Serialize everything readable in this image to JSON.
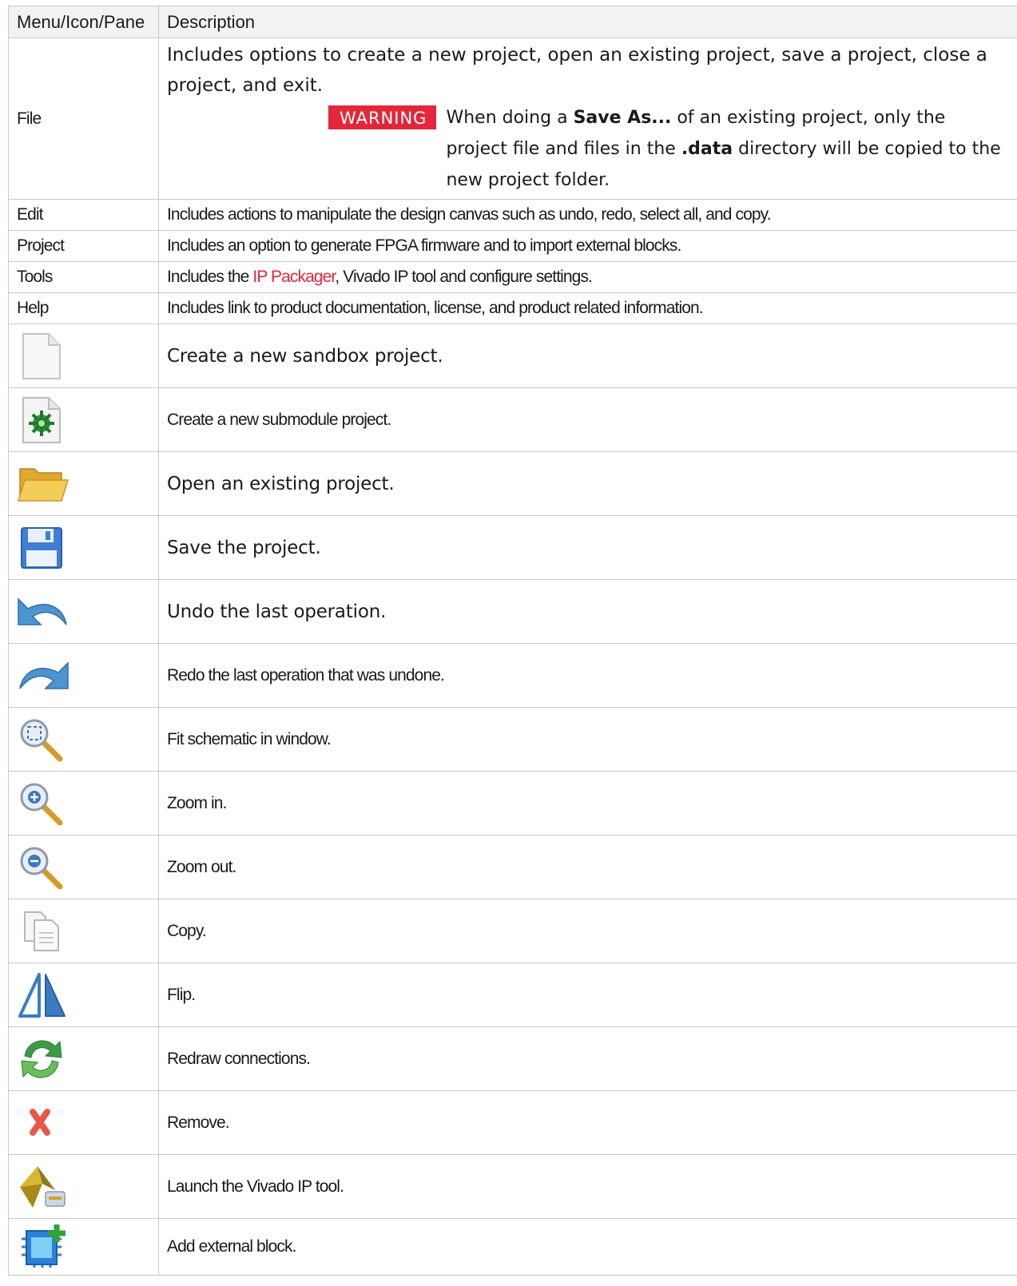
{
  "header": {
    "col1": "Menu/Icon/Pane",
    "col2": "Description"
  },
  "menus": [
    {
      "name": "File",
      "desc": "Includes options to create a new project, open an existing project, save a project, close a project, and exit.",
      "warning": {
        "badge": "WARNING",
        "pre": "When doing a ",
        "b1": "Save As...",
        "mid": " of an existing project, only the project file and files in the ",
        "b2": ".data",
        "post": " directory will be copied to the new project folder."
      }
    },
    {
      "name": "Edit",
      "desc": "Includes actions to manipulate the design canvas such as undo, redo, select all, and copy."
    },
    {
      "name": "Project",
      "desc": "Includes an option to generate FPGA firmware and to import external blocks."
    },
    {
      "name": "Tools",
      "desc_pre": "Includes the ",
      "link": "IP Packager",
      "desc_post": ", Vivado IP tool and configure settings."
    },
    {
      "name": "Help",
      "desc": "Includes link to product documentation, license, and product related information."
    }
  ],
  "icons": [
    {
      "icon": "new-document-icon",
      "desc": "Create a new sandbox project."
    },
    {
      "icon": "new-submodule-icon",
      "desc": "Create a new submodule project."
    },
    {
      "icon": "open-folder-icon",
      "desc": "Open an existing project."
    },
    {
      "icon": "save-floppy-icon",
      "desc": "Save the project."
    },
    {
      "icon": "undo-arrow-icon",
      "desc": "Undo the last operation."
    },
    {
      "icon": "redo-arrow-icon",
      "desc": "Redo the last operation that was undone."
    },
    {
      "icon": "zoom-fit-icon",
      "desc": "Fit schematic in window."
    },
    {
      "icon": "zoom-in-icon",
      "desc": "Zoom in."
    },
    {
      "icon": "zoom-out-icon",
      "desc": "Zoom out."
    },
    {
      "icon": "copy-icon",
      "desc": "Copy."
    },
    {
      "icon": "flip-icon",
      "desc": "Flip."
    },
    {
      "icon": "redraw-icon",
      "desc": "Redraw connections."
    },
    {
      "icon": "remove-x-icon",
      "desc": "Remove."
    },
    {
      "icon": "vivado-ip-icon",
      "desc": "Launch the Vivado IP tool."
    },
    {
      "icon": "add-external-block-icon",
      "desc": "Add external block."
    }
  ],
  "colors": {
    "warning": "#e3263a",
    "link": "#e3263a",
    "border": "#c9c9c9"
  }
}
